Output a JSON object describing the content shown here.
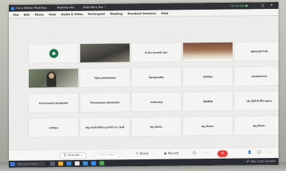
{
  "window": {
    "title": "Cisco Webex Meetings",
    "meeting_info": "Meeting info",
    "hide_menu_bar": "Hide Menu Bar ^",
    "status": "Connected ●",
    "minimize": "–",
    "maximize": "□",
    "close": "✕"
  },
  "menu": [
    "File",
    "Edit",
    "Share",
    "View",
    "Audio & Video",
    "Participant",
    "Meeting",
    "Breakout Sessions",
    "Help"
  ],
  "tiles": {
    "r1c3": "สำนักงานแพทย์ กทพ.",
    "r1c5": "0841407749",
    "r2c2": "Yuka Jantanpaa",
    "r2c3": "Aumpradie",
    "r2c4": "Kittika",
    "r2c5": "wnaphoncy",
    "r3c1": "Pornsawan Janwanta",
    "r3c2": "Pornsawan Janwanta",
    "r3c3": "somrung",
    "r3c4": "WARIN",
    "r3c5": "นพ.เจือกีรติ ศิริกาญจนะ",
    "r4c1": "vrittya",
    "r4c2": "พญ.ดลฤดี ศรีชยางกูรภัทร์ ตะวาพงศ์",
    "r4c3": "พญ.นันทนา",
    "r4c4": "พญ.นันทนา",
    "r4c5": "พญ.นันทนา"
  },
  "toolbar": {
    "mic_icon": "🎙",
    "unmute": "Unmute",
    "chevron": "⌄",
    "start_video": "Start video",
    "share_icon": "⇪",
    "share": "Share",
    "record_icon": "◉",
    "record": "Record",
    "emoji": "☺",
    "more": "⋯",
    "end": "✕",
    "participants_icon": "👤",
    "chat_icon": "💬",
    "more_right": "⋯"
  },
  "taskbar": {
    "search_placeholder": "Type here to search",
    "tray": "^ 🔊 ENG 13:00",
    "date": "1/2/2565"
  },
  "colors": {
    "webex_blue": "#2d8cff",
    "end_red": "#e8403b",
    "taskbar": "#2a2c33"
  }
}
